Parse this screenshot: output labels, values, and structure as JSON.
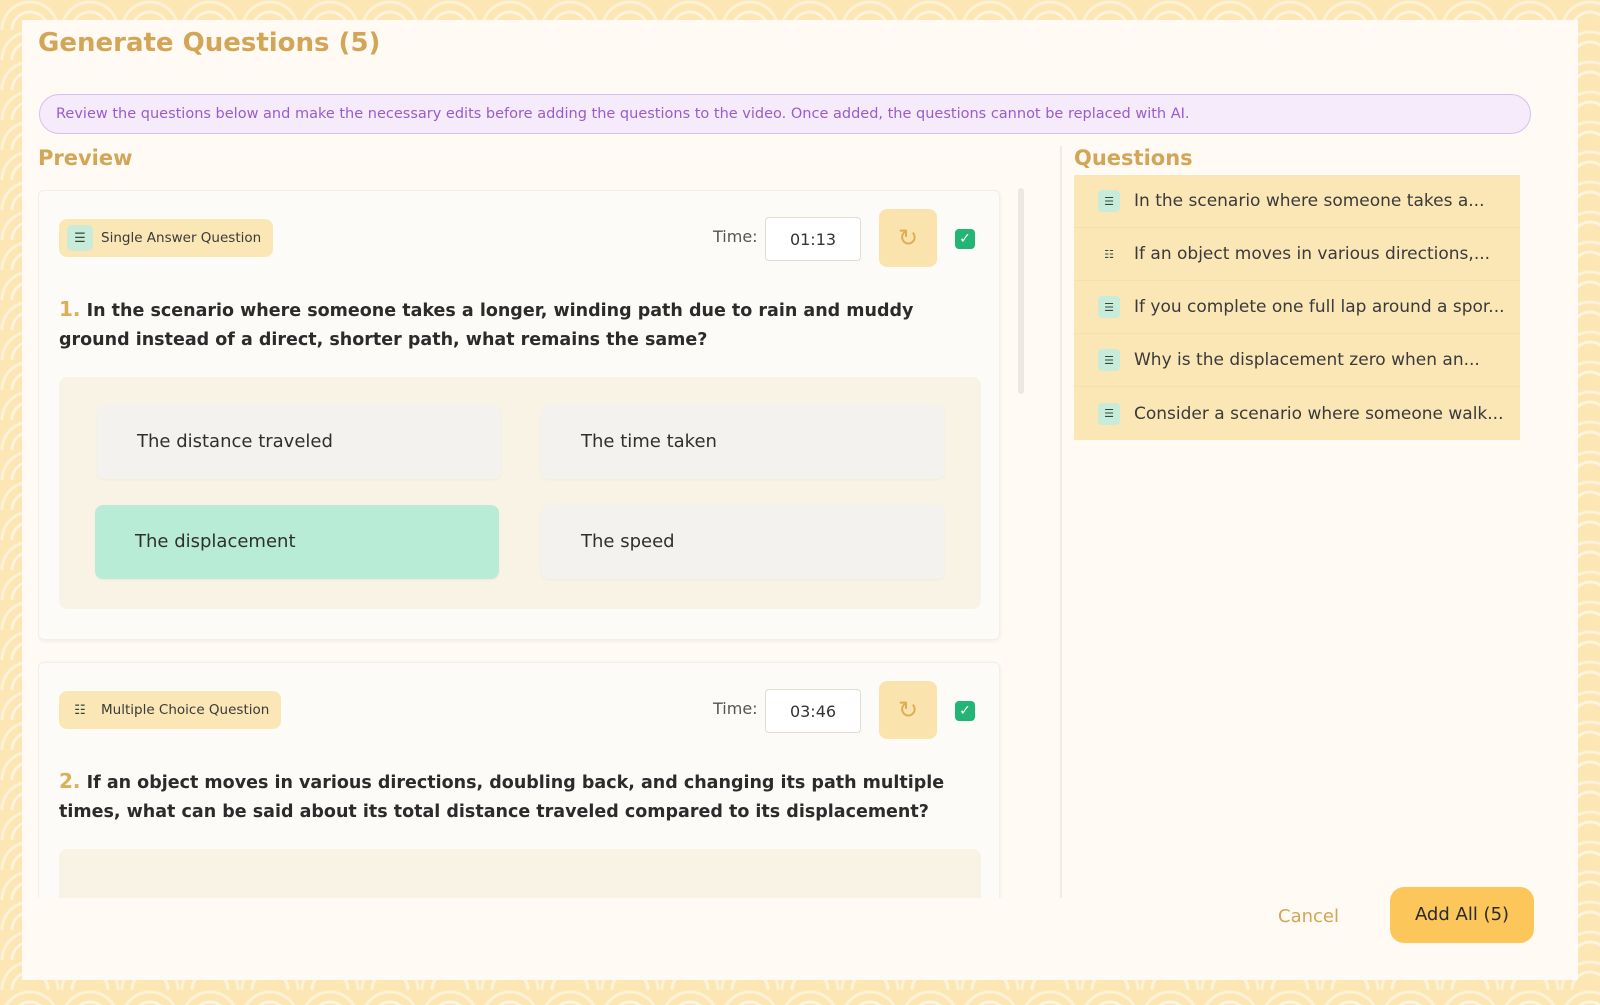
{
  "dialog": {
    "title": "Generate Questions (5)",
    "notice": "Review the questions below and make the necessary edits before adding the questions to the video. Once added, the questions cannot be replaced with AI."
  },
  "preview": {
    "title": "Preview",
    "time_label": "Time:",
    "cards": [
      {
        "type_label": "Single Answer Question",
        "type_icon": "single-answer-icon",
        "time": "01:13",
        "checked": true,
        "number": "1.",
        "question": "In the scenario where someone takes a longer, winding path due to rain and muddy ground instead of a direct, shorter path, what remains the same?",
        "options": [
          "The distance traveled",
          "The time taken",
          "The displacement",
          "The speed"
        ],
        "selected_index": 2
      },
      {
        "type_label": "Multiple Choice Question",
        "type_icon": "multiple-choice-icon",
        "time": "03:46",
        "checked": true,
        "number": "2.",
        "question": "If an object moves in various directions, doubling back, and changing its path multiple times, what can be said about its total distance traveled compared to its displacement?"
      }
    ]
  },
  "questions_panel": {
    "title": "Questions",
    "items": [
      {
        "label": "In the scenario where someone takes a...",
        "icon": "single-answer-icon"
      },
      {
        "label": "If an object moves in various directions,...",
        "icon": "multiple-choice-icon"
      },
      {
        "label": "If you complete one full lap around a spor...",
        "icon": "single-answer-icon"
      },
      {
        "label": "Why is the displacement zero when an...",
        "icon": "single-answer-icon"
      },
      {
        "label": "Consider a scenario where someone walk...",
        "icon": "single-answer-icon"
      }
    ]
  },
  "footer": {
    "cancel_label": "Cancel",
    "add_all_label": "Add All (5)"
  },
  "colors": {
    "accent": "#d2a557",
    "button": "#fcc65b",
    "selected_option": "#b9ecd6",
    "check": "#22b573",
    "notice_text": "#9a5ccc"
  }
}
